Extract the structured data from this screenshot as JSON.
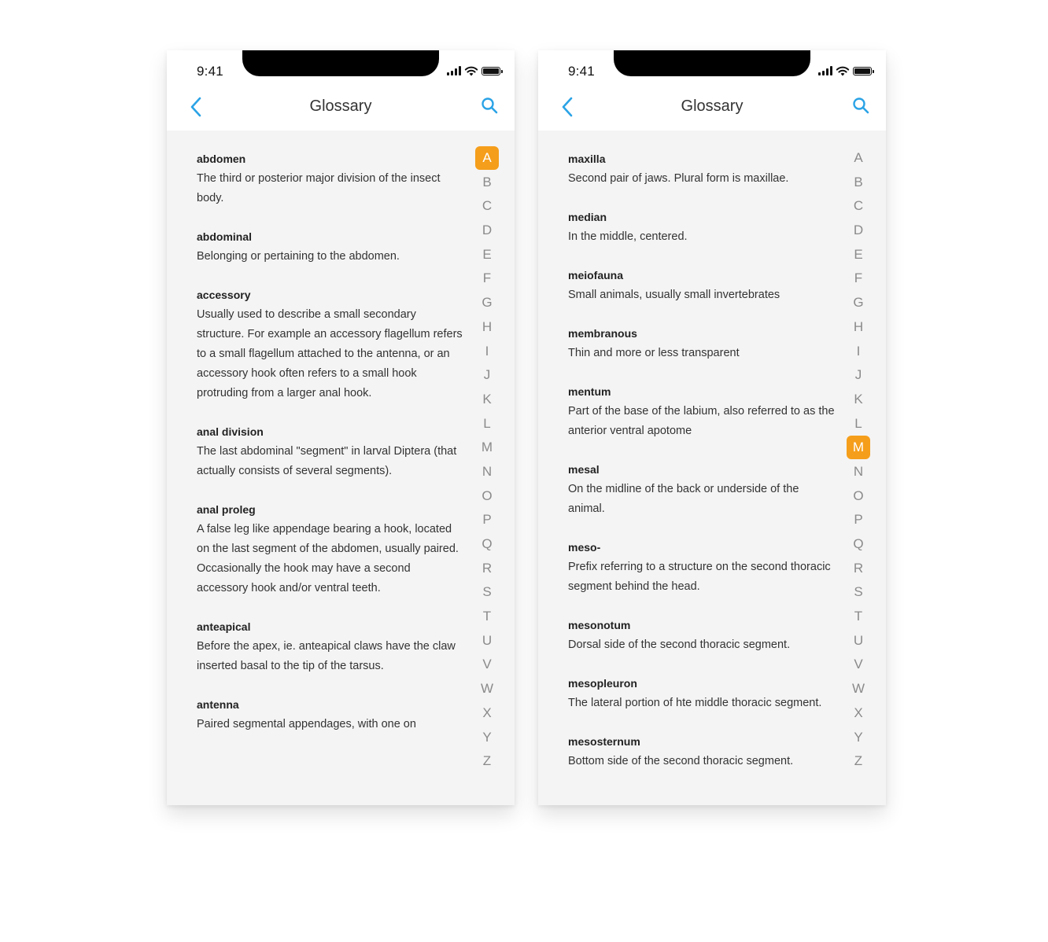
{
  "alphabet": [
    "A",
    "B",
    "C",
    "D",
    "E",
    "F",
    "G",
    "H",
    "I",
    "J",
    "K",
    "L",
    "M",
    "N",
    "O",
    "P",
    "Q",
    "R",
    "S",
    "T",
    "U",
    "V",
    "W",
    "X",
    "Y",
    "Z"
  ],
  "accent_color": "#f59e1b",
  "link_color": "#2ba3e6",
  "screens": [
    {
      "status": {
        "time": "9:41"
      },
      "nav": {
        "title": "Glossary",
        "back_icon": "chevron-left-icon",
        "search_icon": "search-icon"
      },
      "active_letter": "A",
      "entries": [
        {
          "term": "abdomen",
          "definition": "The third or posterior major division of the insect body."
        },
        {
          "term": "abdominal",
          "definition": "Belonging or pertaining to the abdomen."
        },
        {
          "term": "accessory",
          "definition": "Usually used to describe a small secondary structure. For example an accessory flagellum refers to a small flagellum attached to the antenna, or an accessory hook often refers to a small hook protruding from a larger anal hook."
        },
        {
          "term": "anal division",
          "definition": "The last abdominal \"segment\" in larval Diptera (that actually consists of several segments)."
        },
        {
          "term": "anal proleg",
          "definition": "A false leg like appendage bearing a hook, located on the last segment of the abdomen, usually paired.  Occasionally the hook may have a second accessory hook and/or ventral teeth."
        },
        {
          "term": "anteapical",
          "definition": "Before the apex, ie. anteapical claws have the claw inserted basal to the tip of the tarsus."
        },
        {
          "term": "antenna",
          "definition": "Paired segmental appendages, with one on"
        }
      ]
    },
    {
      "status": {
        "time": "9:41"
      },
      "nav": {
        "title": "Glossary",
        "back_icon": "chevron-left-icon",
        "search_icon": "search-icon"
      },
      "active_letter": "M",
      "entries": [
        {
          "term": "maxilla",
          "definition": "Second pair of jaws. Plural form is maxillae."
        },
        {
          "term": "median",
          "definition": " In the middle, centered."
        },
        {
          "term": "meiofauna",
          "definition": "Small animals, usually small invertebrates"
        },
        {
          "term": "membranous",
          "definition": "Thin and more or less transparent"
        },
        {
          "term": "mentum",
          "definition": "Part of the base of the labium, also referred to as the anterior ventral apotome"
        },
        {
          "term": "mesal",
          "definition": "On the midline of the back or underside of the animal."
        },
        {
          "term": "meso-",
          "definition": "Prefix referring to a structure on the second thoracic segment behind the head."
        },
        {
          "term": "mesonotum",
          "definition": "Dorsal side of the second thoracic segment."
        },
        {
          "term": "mesopleuron",
          "definition": "The lateral portion of hte middle thoracic segment."
        },
        {
          "term": "mesosternum",
          "definition": "Bottom side of the second thoracic segment."
        }
      ]
    }
  ]
}
